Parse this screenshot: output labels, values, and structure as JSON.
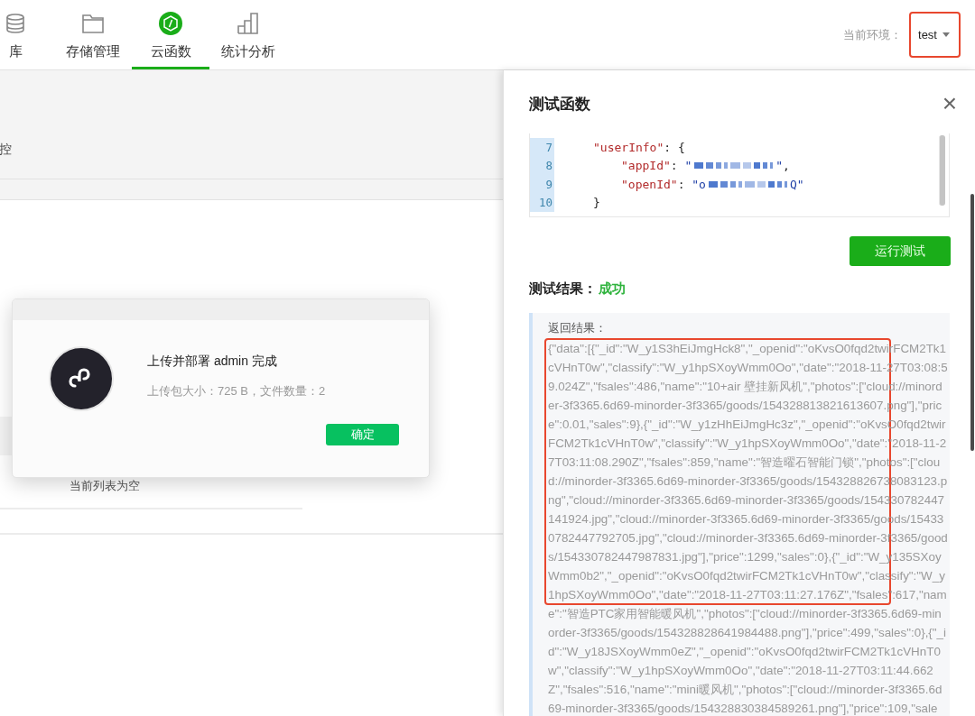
{
  "nav": {
    "tabs": [
      {
        "label": "库",
        "selected": false
      },
      {
        "label": "存储管理",
        "selected": false
      },
      {
        "label": "云函数",
        "selected": true
      },
      {
        "label": "统计分析",
        "selected": false
      }
    ],
    "env": {
      "label": "当前环境：",
      "value": "test"
    }
  },
  "main": {
    "section_label": "控",
    "empty_text": "当前列表为空"
  },
  "dialog": {
    "title": "上传并部署 admin 完成",
    "detail": "上传包大小：725 B，文件数量：2",
    "button": "确定"
  },
  "panel": {
    "title": "测试函数",
    "close": "×",
    "editor": {
      "lines": [
        {
          "number": "7",
          "parts": [
            {
              "kind": "key",
              "text": "\"userInfo\""
            },
            {
              "kind": "punct",
              "text": ": {"
            }
          ],
          "children": [
            {
              "number": "8",
              "parts": [
                {
                  "kind": "key",
                  "text": "\"appId\""
                },
                {
                  "kind": "punct",
                  "text": ": "
                },
                {
                  "kind": "string",
                  "text": "\""
                },
                {
                  "kind": "redacted"
                },
                {
                  "kind": "string",
                  "text": "\""
                },
                {
                  "kind": "punct",
                  "text": ","
                }
              ]
            },
            {
              "number": "9",
              "parts": [
                {
                  "kind": "key",
                  "text": "\"openId\""
                },
                {
                  "kind": "punct",
                  "text": ": "
                },
                {
                  "kind": "string",
                  "text": "\"o"
                },
                {
                  "kind": "redacted"
                },
                {
                  "kind": "string",
                  "text": "Q\""
                }
              ]
            }
          ]
        },
        {
          "number": "10",
          "parts": [
            {
              "kind": "punct",
              "text": "}"
            }
          ]
        }
      ]
    },
    "run_button": "运行测试",
    "result_label": "测试结果：",
    "result_status": "成功",
    "output_label": "返回结果：",
    "output_lines": [
      "{\"data\":[{\"_id\":\"W_y1S3hEiJmgHck8\",\"_openid\":\"oKvsO0fqd2twirFCM2Tk1",
      "cVHnT0w\",\"classify\":\"W_y1hpSXoyWmm0Oo\",\"date\":\"2018-11-27T03:08:5",
      "9.024Z\",\"fsales\":486,\"name\":\"10+air 壁挂新风机\",\"photos\":[\"cloud://minord",
      "er-3f3365.6d69-minorder-3f3365/goods/154328813821613607.png\"],\"pric",
      "e\":0.01,\"sales\":9},{\"_id\":\"W_y1zHhEiJmgHc3z\",\"_openid\":\"oKvsO0fqd2twir",
      "FCM2Tk1cVHnT0w\",\"classify\":\"W_y1hpSXoyWmm0Oo\",\"date\":\"2018-11-2",
      "7T03:11:08.290Z\",\"fsales\":859,\"name\":\"智造曜石智能门锁\",\"photos\":[\"clou",
      "d://minorder-3f3365.6d69-minorder-3f3365/goods/154328826738083123.p",
      "ng\",\"cloud://minorder-3f3365.6d69-minorder-3f3365/goods/154330782447",
      "141924.jpg\",\"cloud://minorder-3f3365.6d69-minorder-3f3365/goods/15433",
      "0782447792705.jpg\",\"cloud://minorder-3f3365.6d69-minorder-3f3365/good",
      "s/154330782447987831.jpg\"],\"price\":1299,\"sales\":0},{\"_id\":\"W_y135SXoy",
      "Wmm0b2\",\"_openid\":\"oKvsO0fqd2twirFCM2Tk1cVHnT0w\",\"classify\":\"W_y",
      "1hpSXoyWmm0Oo\",\"date\":\"2018-11-27T03:11:27.176Z\",\"fsales\":617,\"nam",
      "e\":\"智造PTC家用智能暖风机\",\"photos\":[\"cloud://minorder-3f3365.6d69-min",
      "order-3f3365/goods/154328828641984488.png\"],\"price\":499,\"sales\":0},{\"_i",
      "d\":\"W_y18JSXoyWmm0eZ\",\"_openid\":\"oKvsO0fqd2twirFCM2Tk1cVHnT0",
      "w\",\"classify\":\"W_y1hpSXoyWmm0Oo\",\"date\":\"2018-11-27T03:11:44.662",
      "Z\",\"fsales\":516,\"name\":\"mini暖风机\",\"photos\":[\"cloud://minorder-3f3365.6d",
      "69-minorder-3f3365/goods/154328830384589261.png\"],\"price\":109,\"sale"
    ]
  }
}
